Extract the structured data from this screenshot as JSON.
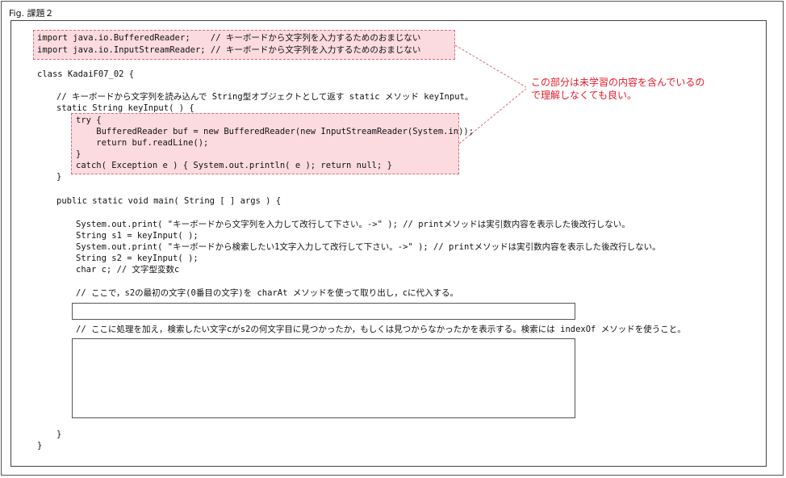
{
  "figure_label": "Fig. 課題２",
  "imports": [
    "import java.io.BufferedReader;    // キーボードから文字列を入力するためのおまじない",
    "import java.io.InputStreamReader; // キーボードから文字列を入力するためのおまじない"
  ],
  "note": "この部分は未学習の内容を含んでいるので理解しなくても良い。",
  "class_decl": "class KadaiF07_02 {",
  "keyinput_comment": "// キーボードから文字列を読み込んで String型オブジェクトとして返す static メソッド keyInput。",
  "keyinput_sig": "static String keyInput( ) {",
  "try_block": [
    "try {",
    "    BufferedReader buf = new BufferedReader(new InputStreamReader(System.in));",
    "    return buf.readLine();",
    "}",
    "catch( Exception e ) { System.out.println( e ); return null; }"
  ],
  "method_close": "}",
  "main_sig": "public static void main( String [ ] args ) {",
  "main_body": [
    "System.out.print( \"キーボードから文字列を入力して改行して下さい。->\" ); // printメソッドは実引数内容を表示した後改行しない。",
    "String s1 = keyInput( );",
    "System.out.print( \"キーボードから検索したい1文字入力して改行して下さい。->\" ); // printメソッドは実引数内容を表示した後改行しない。",
    "String s2 = keyInput( );",
    "char c; // 文字型変数c"
  ],
  "comment_charat": "// ここで，s2の最初の文字(0番目の文字)を charAt メソッドを使って取り出し，cに代入する。",
  "comment_indexof": "// ここに処理を加え，検索したい文字cがs2の何文字目に見つかったか，もしくは見つからなかったかを表示する。検索には indexOf メソッドを使うこと。",
  "main_close": "}",
  "class_close": "}",
  "colors": {
    "highlight": "#fbdbe0",
    "highlight_border": "#e06a80",
    "note_text": "#e81a2a"
  }
}
